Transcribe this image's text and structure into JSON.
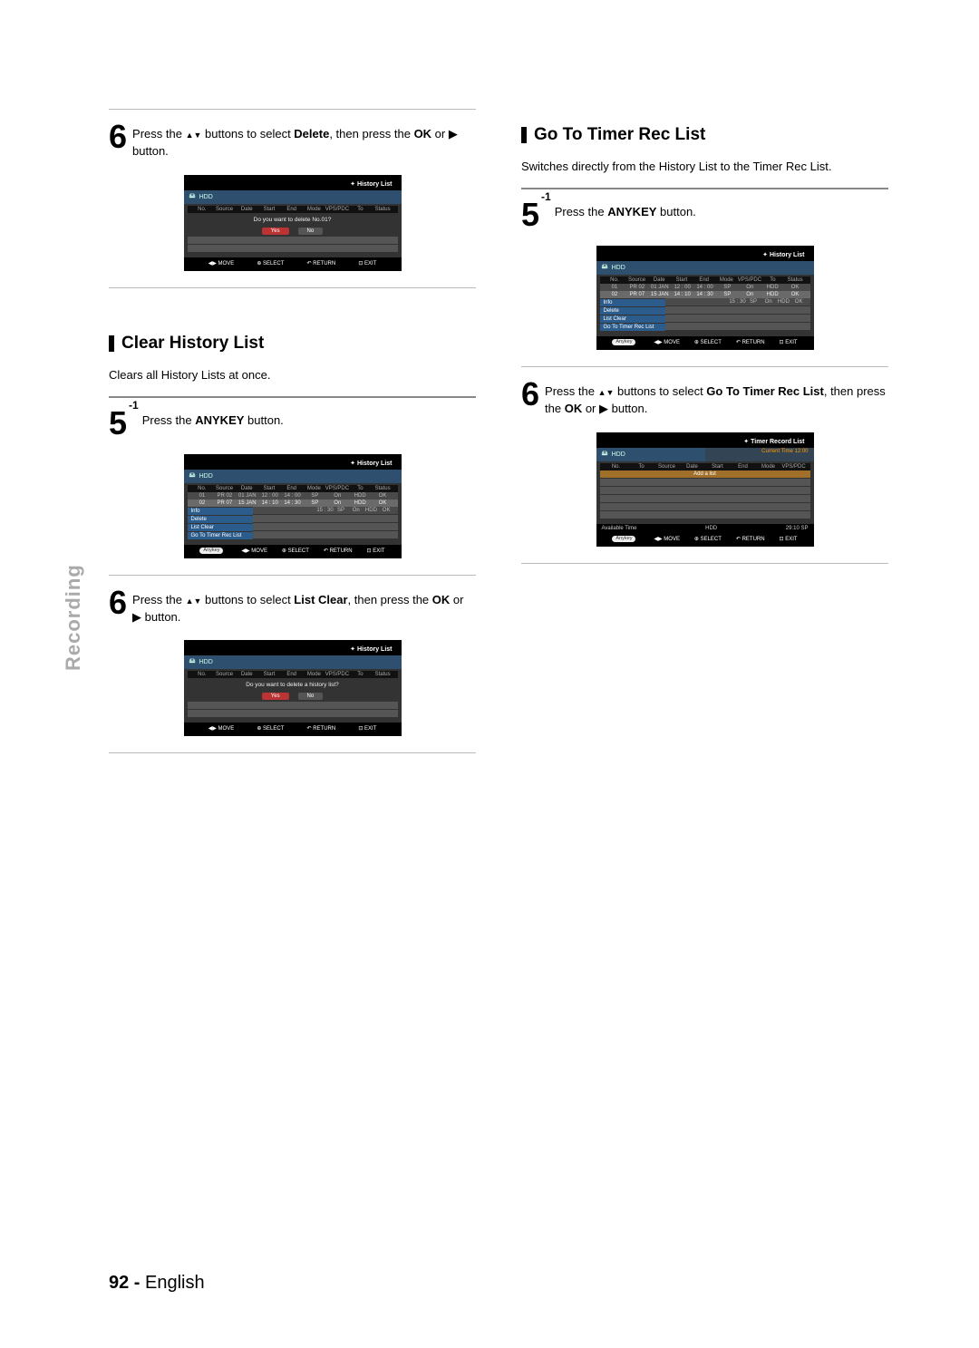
{
  "sideTab": "Recording",
  "footer_page": "92 -",
  "footer_lang": "English",
  "left": {
    "step6a_pre": "Press the ",
    "step6a_mid": " buttons to select ",
    "step6a_bold1": "Delete",
    "step6a_post": ", then press the ",
    "step6a_bold2": "OK",
    "step6a_tail": " or ▶ button.",
    "sectionTitle": "Clear History List",
    "desc": "Clears all History Lists at once.",
    "step5_pre": "Press the ",
    "step5_bold": "ANYKEY",
    "step5_post": " button.",
    "step5_sup": "-1",
    "step6b_pre": "Press the ",
    "step6b_mid": " buttons to select ",
    "step6b_bold1": "List Clear",
    "step6b_post": ", then press the ",
    "step6b_bold2": "OK",
    "step6b_tail": " or ▶ button."
  },
  "right": {
    "sectionTitle": "Go To Timer Rec List",
    "desc": "Switches directly from the History List to the Timer Rec List.",
    "step5_pre": "Press the ",
    "step5_bold": "ANYKEY",
    "step5_post": " button.",
    "step5_sup": "-1",
    "step6_pre": "Press the ",
    "step6_mid": " buttons to select ",
    "step6_bold1": "Go To Timer Rec List",
    "step6_post": ", then press the ",
    "step6_bold2": "OK",
    "step6_tail": " or ▶ button."
  },
  "screens": {
    "title_history": "History List",
    "title_timer": "Timer Record List",
    "hdd": "HDD",
    "hdr_no": "No.",
    "hdr_src": "Source",
    "hdr_date": "Date",
    "hdr_start": "Start",
    "hdr_end": "End",
    "hdr_mode": "Mode",
    "hdr_vps": "VPS/PDC",
    "hdr_to": "To",
    "hdr_status": "Status",
    "rows": [
      {
        "no": "01",
        "src": "PR 02",
        "date": "01 JAN",
        "start": "12 : 00",
        "end": "14 : 00",
        "mode": "SP",
        "vps": "On",
        "to": "HDD",
        "status": "OK"
      },
      {
        "no": "02",
        "src": "PR 07",
        "date": "15 JAN",
        "start": "14 : 10",
        "end": "14 : 30",
        "mode": "SP",
        "vps": "On",
        "to": "HDD",
        "status": "OK"
      },
      {
        "no": "",
        "src": "",
        "date": "",
        "start": "",
        "end": "15 : 30",
        "mode": "SP",
        "vps": "On",
        "to": "HDD",
        "status": "OK"
      }
    ],
    "dialog_del": "Do you want to delete No.01?",
    "dialog_clear": "Do you want to delete a history list?",
    "yes": "Yes",
    "no": "No",
    "menu": [
      "Info",
      "Delete",
      "List Clear",
      "Go To Timer Rec List"
    ],
    "add_item": "Add a list",
    "avail": "Available Time",
    "avail_hd": "HDD",
    "avail_t": "29:10 SP",
    "curtime": "Current Time 12:00",
    "foot": [
      "MOVE",
      "SELECT",
      "RETURN",
      "EXIT"
    ],
    "anykey": "Anykey",
    "timer_hdr": [
      "No.",
      "To",
      "Source",
      "Date",
      "Start",
      "End",
      "Mode",
      "VPS/PDC"
    ]
  }
}
